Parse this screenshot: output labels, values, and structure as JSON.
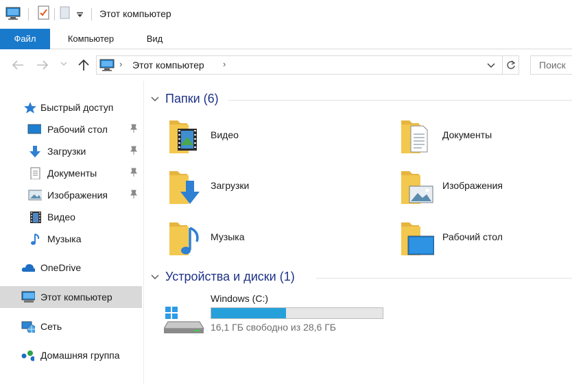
{
  "window": {
    "title": "Этот компьютер"
  },
  "ribbon": {
    "tabs": [
      "Файл",
      "Компьютер",
      "Вид"
    ],
    "active_tab": "Файл"
  },
  "address": {
    "path_label": "Этот компьютер",
    "search_placeholder": "Поиск"
  },
  "sidebar": {
    "items": [
      {
        "label": "Быстрый доступ",
        "icon": "star-icon",
        "pinned": false
      },
      {
        "label": "Рабочий стол",
        "icon": "desktop-icon",
        "pinned": true
      },
      {
        "label": "Загрузки",
        "icon": "downloads-icon",
        "pinned": true
      },
      {
        "label": "Документы",
        "icon": "documents-icon",
        "pinned": true
      },
      {
        "label": "Изображения",
        "icon": "pictures-icon",
        "pinned": true
      },
      {
        "label": "Видео",
        "icon": "video-icon",
        "pinned": false
      },
      {
        "label": "Музыка",
        "icon": "music-icon",
        "pinned": false
      },
      {
        "label": "OneDrive",
        "icon": "onedrive-icon",
        "pinned": false
      },
      {
        "label": "Этот компьютер",
        "icon": "computer-icon",
        "pinned": false,
        "selected": true
      },
      {
        "label": "Сеть",
        "icon": "network-icon",
        "pinned": false
      },
      {
        "label": "Домашняя группа",
        "icon": "homegroup-icon",
        "pinned": false
      }
    ]
  },
  "folders_group": {
    "title": "Папки (6)",
    "folders": [
      {
        "label": "Видео",
        "icon": "video-folder-icon"
      },
      {
        "label": "Документы",
        "icon": "documents-folder-icon"
      },
      {
        "label": "Загрузки",
        "icon": "downloads-folder-icon"
      },
      {
        "label": "Изображения",
        "icon": "pictures-folder-icon"
      },
      {
        "label": "Музыка",
        "icon": "music-folder-icon"
      },
      {
        "label": "Рабочий стол",
        "icon": "desktop-folder-icon"
      }
    ]
  },
  "devices_group": {
    "title": "Устройства и диски (1)",
    "drive": {
      "name": "Windows (C:)",
      "info": "16,1 ГБ свободно из 28,6 ГБ",
      "used_fraction": 0.437
    }
  },
  "colors": {
    "accent": "#1979ca",
    "drive_bar": "#26a0da",
    "group_title": "#1e3287",
    "folder": "#f3c84f"
  }
}
